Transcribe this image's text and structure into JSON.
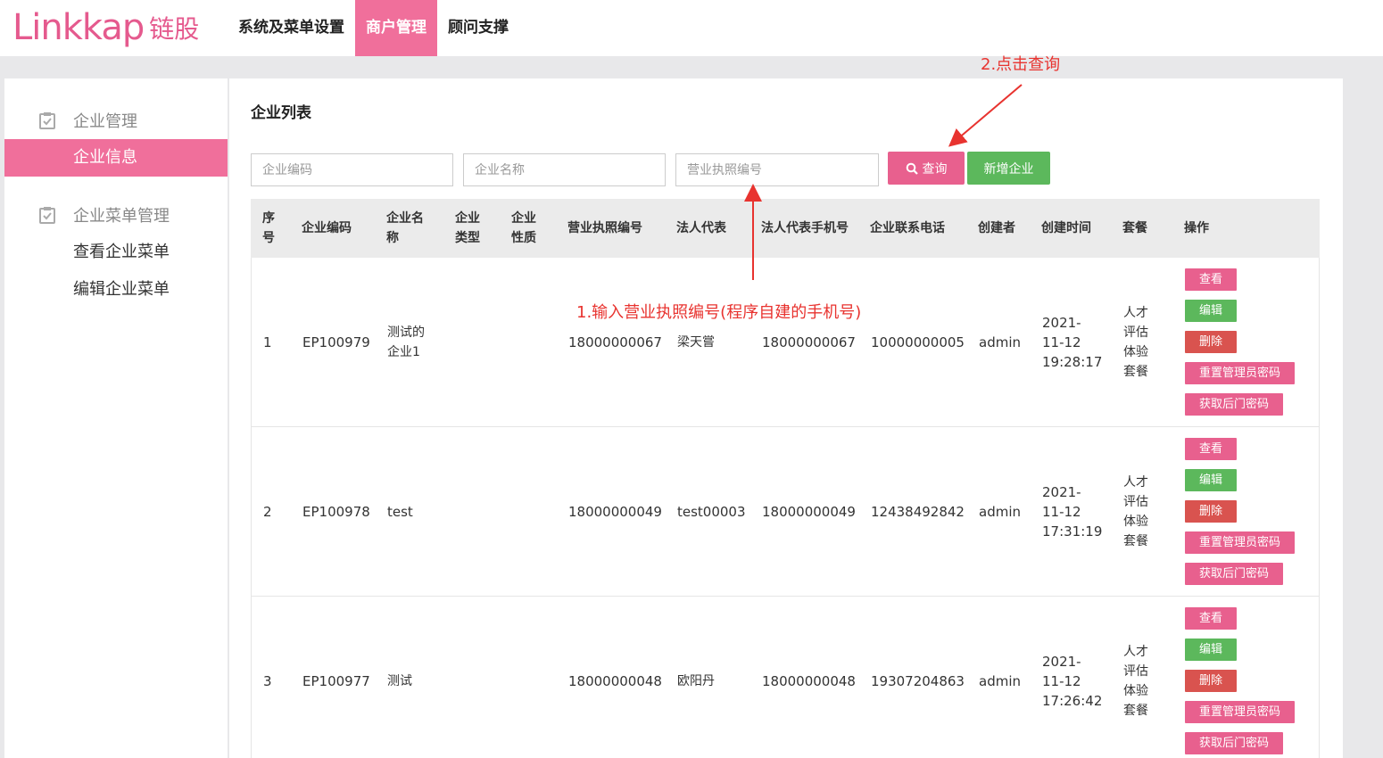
{
  "header": {
    "logo_en": "Linkkap",
    "logo_cn": "链股",
    "nav": [
      {
        "label": "系统及菜单设置",
        "active": false
      },
      {
        "label": "商户管理",
        "active": true
      },
      {
        "label": "顾问支撑",
        "active": false
      }
    ]
  },
  "sidebar": {
    "groups": [
      {
        "label": "企业管理",
        "items": [
          {
            "label": "企业信息",
            "active": true
          }
        ]
      },
      {
        "label": "企业菜单管理",
        "items": [
          {
            "label": "查看企业菜单",
            "active": false
          },
          {
            "label": "编辑企业菜单",
            "active": false
          }
        ]
      }
    ]
  },
  "main": {
    "title": "企业列表",
    "search": {
      "code_placeholder": "企业编码",
      "name_placeholder": "企业名称",
      "license_placeholder": "营业执照编号",
      "query_label": "查询",
      "add_label": "新增企业"
    },
    "table": {
      "headers": [
        "序号",
        "企业编码",
        "企业名称",
        "企业类型",
        "企业性质",
        "营业执照编号",
        "法人代表",
        "法人代表手机号",
        "企业联系电话",
        "创建者",
        "创建时间",
        "套餐",
        "操作"
      ],
      "rows": [
        {
          "no": "1",
          "code": "EP100979",
          "name": "测试的企业1",
          "type": "",
          "nature": "",
          "license": "18000000067",
          "legal": "梁天嘗",
          "legal_phone": "18000000067",
          "phone": "10000000005",
          "creator": "admin",
          "created": "2021-11-12 19:28:17",
          "package": "人才评估体验套餐"
        },
        {
          "no": "2",
          "code": "EP100978",
          "name": "test",
          "type": "",
          "nature": "",
          "license": "18000000049",
          "legal": "test00003",
          "legal_phone": "18000000049",
          "phone": "12438492842",
          "creator": "admin",
          "created": "2021-11-12 17:31:19",
          "package": "人才评估体验套餐"
        },
        {
          "no": "3",
          "code": "EP100977",
          "name": "测试",
          "type": "",
          "nature": "",
          "license": "18000000048",
          "legal": "欧阳丹",
          "legal_phone": "18000000048",
          "phone": "19307204863",
          "creator": "admin",
          "created": "2021-11-12 17:26:42",
          "package": "人才评估体验套餐"
        }
      ],
      "ops": {
        "view": "查看",
        "edit": "编辑",
        "delete": "删除",
        "reset": "重置管理员密码",
        "backdoor": "获取后门密码"
      }
    }
  },
  "annotations": {
    "step1": "1.输入营业执照编号(程序自建的手机号)",
    "step2": "2.点击查询"
  },
  "colors": {
    "brand_pink": "#f06f9b",
    "query_pink": "#e8608e",
    "green": "#5cb85c",
    "red": "#d9534f",
    "annotation_red": "#e8332f"
  }
}
